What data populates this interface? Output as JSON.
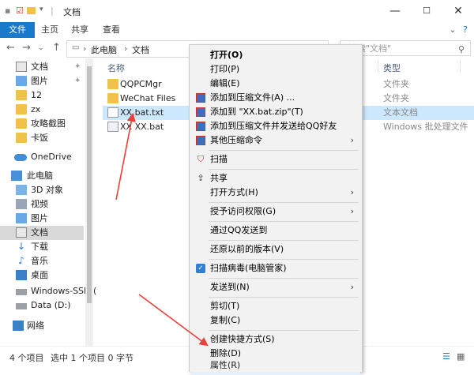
{
  "window": {
    "title": "文档"
  },
  "ribbon": {
    "tabs": [
      "文件",
      "主页",
      "共享",
      "查看"
    ]
  },
  "address": {
    "path": [
      "此电脑",
      "文档"
    ],
    "search_placeholder": "搜索\"文档\""
  },
  "sidebar": {
    "items": [
      {
        "label": "文档",
        "icon": "document-icon",
        "pinned": true
      },
      {
        "label": "图片",
        "icon": "picture-icon",
        "pinned": true
      },
      {
        "label": "12",
        "icon": "folder-icon"
      },
      {
        "label": "zx",
        "icon": "folder-icon"
      },
      {
        "label": "攻略截图",
        "icon": "folder-icon"
      },
      {
        "label": "卡饭",
        "icon": "folder-icon"
      },
      {
        "label": "OneDrive",
        "icon": "cloud-icon"
      },
      {
        "label": "此电脑",
        "icon": "computer-icon"
      },
      {
        "label": "3D 对象",
        "icon": "3d-objects-icon"
      },
      {
        "label": "视频",
        "icon": "video-icon"
      },
      {
        "label": "图片",
        "icon": "picture-icon"
      },
      {
        "label": "文档",
        "icon": "document-icon",
        "selected": true
      },
      {
        "label": "下载",
        "icon": "download-icon"
      },
      {
        "label": "音乐",
        "icon": "music-icon"
      },
      {
        "label": "桌面",
        "icon": "desktop-icon"
      },
      {
        "label": "Windows-SSD (",
        "icon": "drive-icon"
      },
      {
        "label": "Data (D:)",
        "icon": "drive-icon"
      },
      {
        "label": "网络",
        "icon": "network-icon"
      }
    ]
  },
  "files": {
    "headers": {
      "name": "名称",
      "type": "类型"
    },
    "rows": [
      {
        "name": "QQPCMgr",
        "type": "文件夹",
        "kind": "folder"
      },
      {
        "name": "WeChat Files",
        "type": "文件夹",
        "kind": "folder"
      },
      {
        "name": "XX.bat.txt",
        "type": "文本文档",
        "kind": "file",
        "selected": true
      },
      {
        "name": "XX XX.bat",
        "type": "Windows 批处理文件",
        "kind": "file"
      }
    ]
  },
  "status": {
    "count": "4 个项目",
    "selection": "选中 1 个项目 0 字节"
  },
  "context_menu": {
    "items": [
      {
        "label": "打开(O)",
        "bold": true
      },
      {
        "label": "打印(P)"
      },
      {
        "label": "编辑(E)"
      },
      {
        "label": "添加到压缩文件(A) ...",
        "icon": "archive-icon"
      },
      {
        "label": "添加到 \"XX.bat.zip\"(T)",
        "icon": "archive-icon"
      },
      {
        "label": "添加到压缩文件并发送给QQ好友",
        "icon": "archive-icon"
      },
      {
        "label": "其他压缩命令",
        "icon": "archive-icon",
        "submenu": true
      },
      {
        "label": "扫描",
        "icon": "shield-icon"
      },
      {
        "label": "共享",
        "icon": "share-icon"
      },
      {
        "label": "打开方式(H)",
        "submenu": true
      },
      {
        "label": "授予访问权限(G)",
        "submenu": true
      },
      {
        "label": "通过QQ发送到"
      },
      {
        "label": "还原以前的版本(V)"
      },
      {
        "label": "扫描病毒(电脑管家)",
        "icon": "security-shield-icon"
      },
      {
        "label": "发送到(N)",
        "submenu": true
      },
      {
        "label": "剪切(T)"
      },
      {
        "label": "复制(C)"
      },
      {
        "label": "创建快捷方式(S)"
      },
      {
        "label": "删除(D)"
      },
      {
        "label": "重命名(M)",
        "highlighted": true
      },
      {
        "label": "属性(R)"
      }
    ]
  },
  "colors": {
    "accent": "#1979ca",
    "annotation_arrow": "#e8413a",
    "folder": "#f0c24a"
  }
}
